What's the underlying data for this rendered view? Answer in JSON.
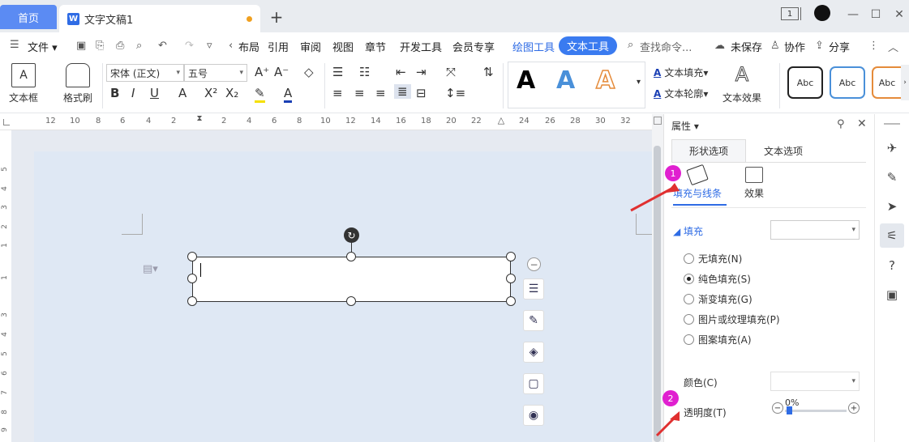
{
  "titlebar": {
    "home_tab": "首页",
    "doc_tab": "文字文稿1",
    "doc_icon": "W",
    "add_tab": "+",
    "page_indicator": "1"
  },
  "menubar": {
    "file": "文件",
    "items": [
      "布局",
      "引用",
      "审阅",
      "视图",
      "章节",
      "开发工具",
      "会员专享"
    ],
    "drawing_tools": "绘图工具",
    "text_tools": "文本工具",
    "search_placeholder": "查找命令...",
    "unsaved": "未保存",
    "collaborate": "协作",
    "share": "分享"
  },
  "ribbon": {
    "textbox": "文本框",
    "format_painter": "格式刷",
    "font_name": "宋体 (正文)",
    "font_size": "五号",
    "text_fill": "文本填充",
    "text_outline": "文本轮廓",
    "text_effects": "文本效果",
    "art_letter": "A",
    "style_abc": "Abc"
  },
  "ruler": {
    "h_marks": [
      "12",
      "10",
      "8",
      "6",
      "4",
      "2",
      "2",
      "4",
      "6",
      "8",
      "10",
      "12",
      "14",
      "16",
      "18",
      "20",
      "22",
      "24",
      "26",
      "28",
      "30",
      "32"
    ],
    "v_marks": [
      "5",
      "4",
      "3",
      "2",
      "1",
      "1",
      "3",
      "4",
      "5",
      "6",
      "7",
      "8",
      "9"
    ]
  },
  "pane": {
    "title": "属性",
    "tab_shape": "形状选项",
    "tab_text": "文本选项",
    "sub_fill": "填充与线条",
    "sub_effect": "效果",
    "fill_header": "填充",
    "options": [
      "无填充(N)",
      "纯色填充(S)",
      "渐变填充(G)",
      "图片或纹理填充(P)",
      "图案填充(A)"
    ],
    "selected_option": "纯色填充(S)",
    "color_label": "颜色(C)",
    "transparency_label": "透明度(T)",
    "transparency_value": "0%"
  },
  "badges": [
    "1",
    "2"
  ],
  "colors": {
    "accent": "#2f6ce5",
    "home_tab": "#5b8bf3",
    "badge": "#e020d0",
    "arrow": "#e03030"
  }
}
